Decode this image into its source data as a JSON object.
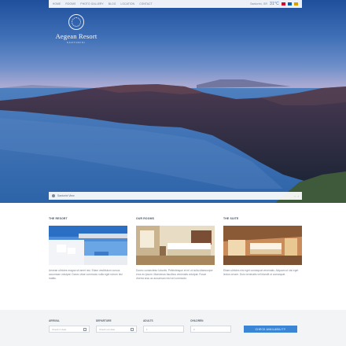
{
  "nav": {
    "items": [
      "Home",
      "Rooms",
      "Photo Gallery",
      "Blog",
      "Location",
      "Contact"
    ],
    "location_label": "Santorini, GR",
    "temperature": "31°C"
  },
  "brand": {
    "name": "Aegean Resort",
    "tagline": "SANTORINI"
  },
  "hero": {
    "caption": "Santorini View"
  },
  "features": [
    {
      "title": "The Resort",
      "text": "Aenean ultricies magna sit amet nisi. Etiam vestibulum cursus accumsan volutpat. Donec vitae commodo nulla eget rutrum nisl mattis."
    },
    {
      "title": "Our Rooms",
      "text": "Donec consectetur lobortis. Pellentesque et mi ut nulla ullamcorper eros eu ipsum. Maecenas faucibus venenatis volutpat. Fusce viverra arcu ac accumsan nisl vel commodo."
    },
    {
      "title": "The Suite",
      "text": "Etiam ultricies nisi eget consequat venenatis. Aliquam ut nisi eget lectus ornare. Duis venenatis vel blandit ut consequat."
    }
  ],
  "booking": {
    "arrival_label": "Arrival",
    "arrival_placeholder": "Check in date",
    "departure_label": "Departure",
    "departure_placeholder": "Check out date",
    "adults_label": "Adults",
    "adults_value": "1",
    "children_label": "Children",
    "children_value": "0",
    "submit_label": "Check Availability"
  },
  "colors": {
    "accent": "#3a86d4",
    "sky_top": "#1f4f9b",
    "sea": "#2f66aa"
  }
}
